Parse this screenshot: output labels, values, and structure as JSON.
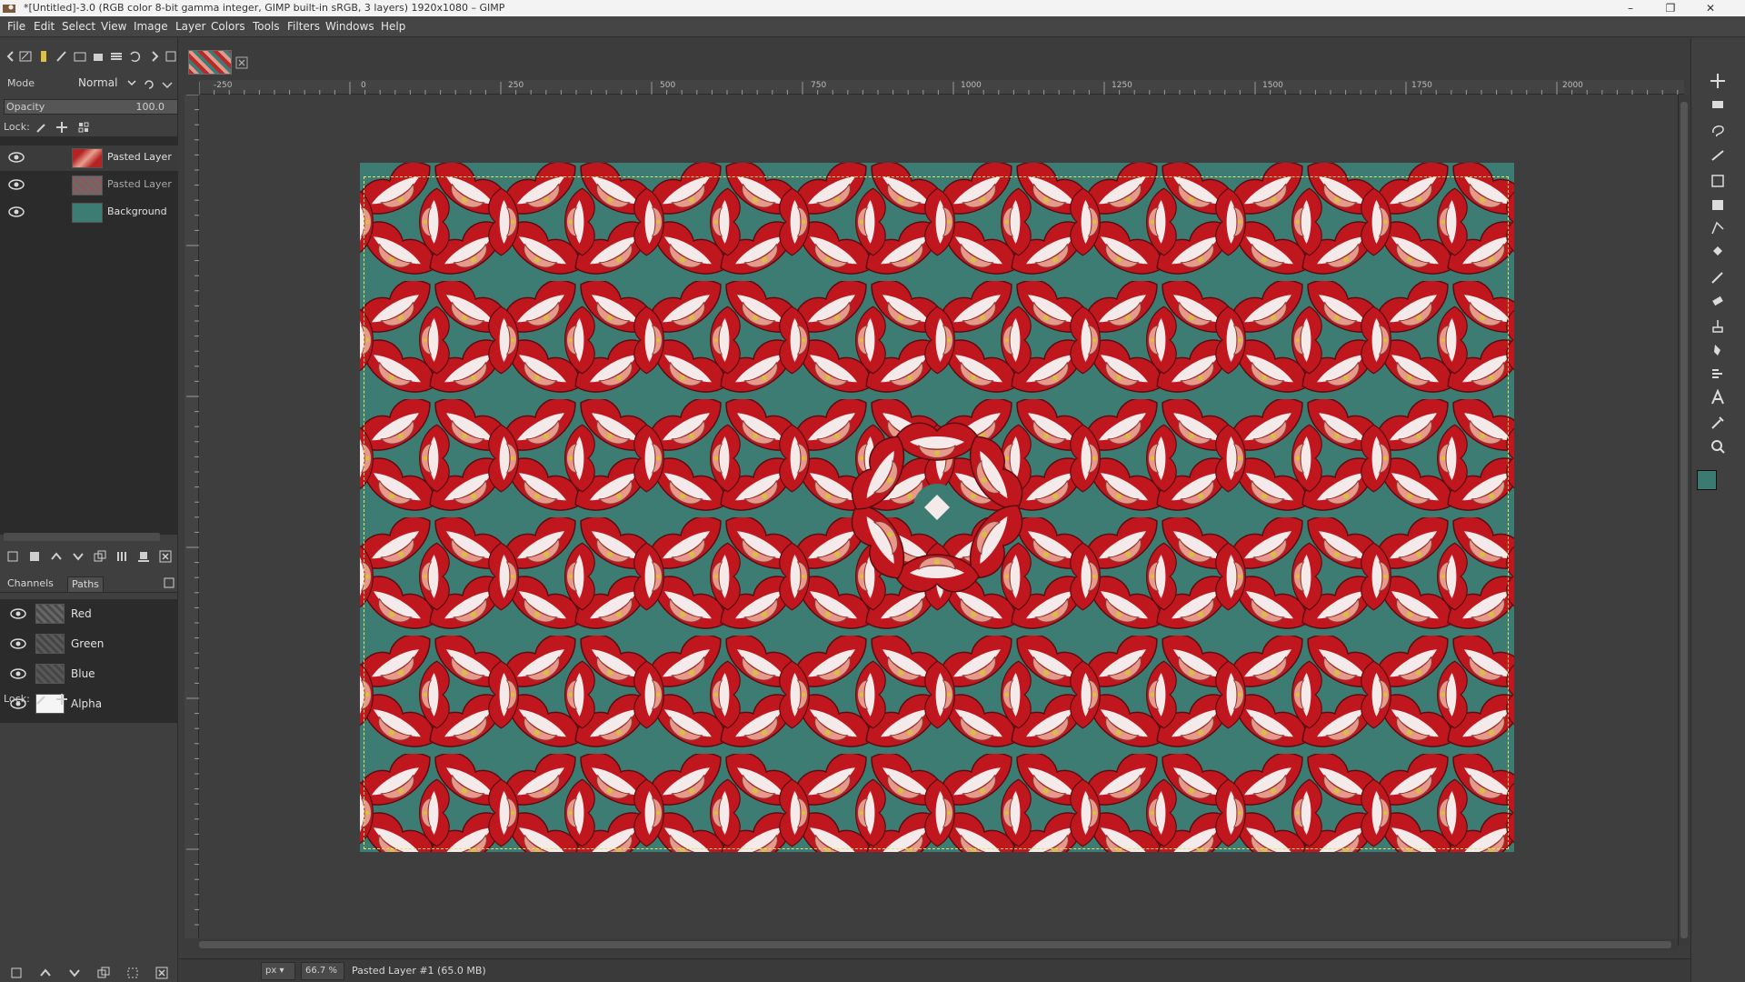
{
  "window": {
    "title": "*[Untitled]-3.0 (RGB color 8-bit gamma integer, GIMP built-in sRGB, 3 layers) 1920x1080 – GIMP",
    "minimize": "–",
    "restore": "❐",
    "close": "✕"
  },
  "menu": [
    "File",
    "Edit",
    "Select",
    "View",
    "Image",
    "Layer",
    "Colors",
    "Tools",
    "Filters",
    "Windows",
    "Help"
  ],
  "layers_panel": {
    "mode_label": "Mode",
    "mode_value": "Normal",
    "opacity_label": "Opacity",
    "opacity_value": "100.0",
    "lock_label": "Lock:",
    "layers": [
      {
        "name": "Pasted Layer",
        "active": true
      },
      {
        "name": "Pasted Layer",
        "active": false
      },
      {
        "name": "Background",
        "active": false
      }
    ]
  },
  "channels_panel": {
    "tabs": [
      "Channels",
      "Paths"
    ],
    "channels": [
      "Red",
      "Green",
      "Blue",
      "Alpha"
    ],
    "lock_label": "Lock:"
  },
  "rulers": {
    "top": [
      "-250",
      "0",
      "250",
      "500",
      "750",
      "1000",
      "1250",
      "1500",
      "1750",
      "2000"
    ]
  },
  "statusbar": {
    "unit": "px",
    "zoom": "66.7 %",
    "message": "Pasted Layer #1 (65.0 MB)"
  },
  "colors": {
    "foreground": "#3a7a70",
    "background": "#e8e64a",
    "canvas_teal": "#3d7c73",
    "lip_red": "#c0171e",
    "tongue_pink": "#e89a8a"
  }
}
